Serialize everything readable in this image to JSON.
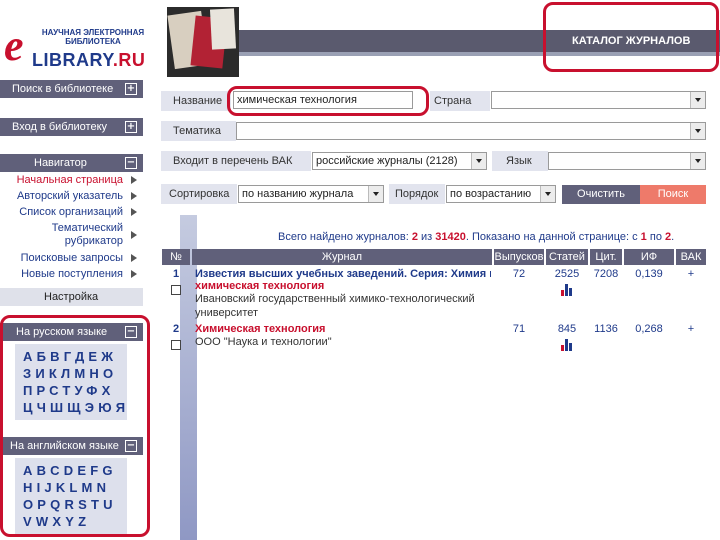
{
  "logo": {
    "tagline": "НАУЧНАЯ ЭЛЕКТРОННАЯ БИБЛИОТЕКА",
    "brand_main": "LIBRARY",
    "brand_ru": ".RU"
  },
  "header": {
    "catalog_title": "КАТАЛОГ ЖУРНАЛОВ"
  },
  "sidebar": {
    "search_library": "Поиск в библиотеке",
    "login_library": "Вход в библиотеку",
    "navigator": "Навигатор",
    "nav_items": [
      {
        "label": "Начальная страница"
      },
      {
        "label": "Авторский указатель"
      },
      {
        "label": "Список организаций"
      },
      {
        "label": "Тематический рубрикатор"
      },
      {
        "label": "Поисковые запросы"
      },
      {
        "label": "Новые поступления"
      }
    ],
    "settings": "Настройка",
    "russian_head": "На русском языке",
    "russian_rows": [
      "АБВГДЕЖ",
      "ЗИКЛМНО",
      "ПРСТУФХ",
      "ЦЧШЩЭЮЯ"
    ],
    "english_head": "На английском языке",
    "english_rows": [
      "ABCDEFG",
      "HIJKLMN",
      "OPQRSTU",
      "VWXYZ"
    ]
  },
  "form": {
    "name_label": "Название",
    "name_value": "химическая технология",
    "country_label": "Страна",
    "country_value": "",
    "topic_label": "Тематика",
    "topic_value": "",
    "vak_label": "Входит в перечень ВАК",
    "vak_value": "российские журналы (2128)",
    "lang_label": "Язык",
    "lang_value": "",
    "sort_label": "Сортировка",
    "sort_value": "по названию журнала",
    "order_label": "Порядок",
    "order_value": "по возрастанию",
    "clear_button": "Очистить",
    "search_button": "Поиск"
  },
  "summary": {
    "prefix": "Всего найдено журналов:",
    "found": "2",
    "of_word": "из",
    "total": "31420",
    "shown_text": ". Показано на данной странице: с",
    "from": "1",
    "to_word": "по",
    "to": "2",
    "suffix": "."
  },
  "table": {
    "headers": {
      "num": "№",
      "journal": "Журнал",
      "issues": "Выпусков",
      "articles": "Статей",
      "citations": "Цит.",
      "impact": "ИФ РИНЦ",
      "vak": "ВАК"
    },
    "rows": [
      {
        "num": "1",
        "title": "Известия высших учебных заведений. Серия: Химия и химическая технология",
        "subtitle": "химическая технология",
        "publisher": "Ивановский государственный химико-технологический университет",
        "issues": "72",
        "articles": "2525",
        "citations": "7208",
        "impact": "0,139",
        "vak": "+"
      },
      {
        "num": "2",
        "title": "Химическая технология",
        "publisher": "ООО \"Наука и технологии\"",
        "issues": "71",
        "articles": "845",
        "citations": "1136",
        "impact": "0,268",
        "vak": "+"
      }
    ]
  },
  "colors": {
    "accent_red": "#c8102e",
    "nav_blue": "#1f3a8a",
    "bar_gray": "#60607a"
  }
}
